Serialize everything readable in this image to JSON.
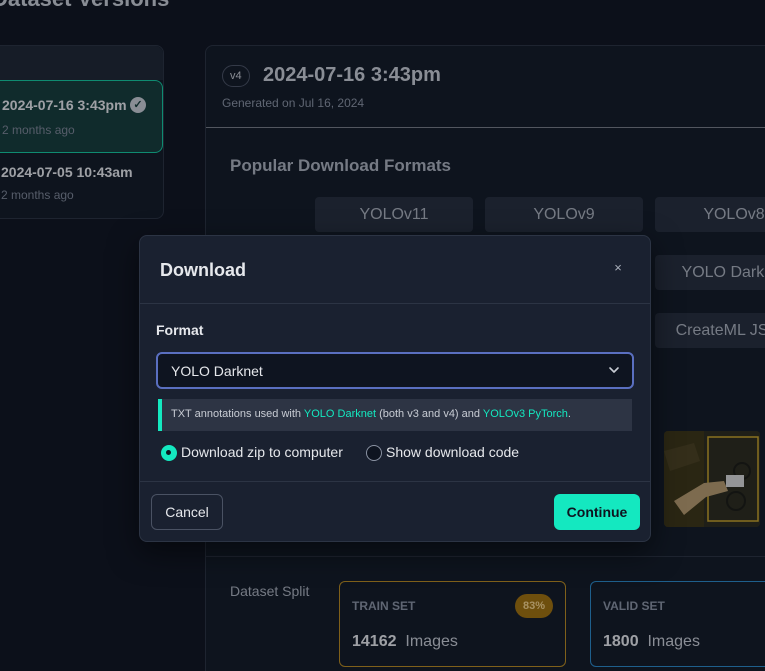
{
  "page": {
    "title": "Dataset Versions"
  },
  "versions": {
    "items": [
      {
        "title": "2024-07-16 3:43pm",
        "subtitle": "2 months ago",
        "selected": true
      },
      {
        "title": "2024-07-05 10:43am",
        "subtitle": "2 months ago",
        "selected": false
      }
    ]
  },
  "version": {
    "badge": "v4",
    "title": "2024-07-16 3:43pm",
    "generated": "Generated on Jul 16, 2024"
  },
  "formats": {
    "section_title": "Popular Download Formats",
    "buttons": [
      "YOLOv11",
      "YOLOv9",
      "YOLOv8",
      "YOLO Darknet",
      "CreateML JSON"
    ]
  },
  "split": {
    "label": "Dataset Split",
    "train": {
      "name": "TRAIN SET",
      "count": "14162",
      "unit": "Images",
      "percent": "83%"
    },
    "valid": {
      "name": "VALID SET",
      "count": "1800",
      "unit": "Images"
    }
  },
  "modal": {
    "title": "Download",
    "close_icon": "×",
    "format_label": "Format",
    "selected_format": "YOLO Darknet",
    "info": {
      "prefix": "TXT annotations used with ",
      "link1": "YOLO Darknet",
      "middle": " (both v3 and v4) and ",
      "link2": "YOLOv3 PyTorch",
      "suffix": "."
    },
    "options": [
      {
        "label": "Download zip to computer",
        "checked": true
      },
      {
        "label": "Show download code",
        "checked": false
      }
    ],
    "cancel_label": "Cancel",
    "continue_label": "Continue"
  },
  "colors": {
    "accent": "#14e8c0",
    "background": "#0f141f",
    "panel": "#131a26",
    "modal": "#1a2130",
    "train_border": "#b88a1f",
    "valid_border": "#2a88c8"
  }
}
